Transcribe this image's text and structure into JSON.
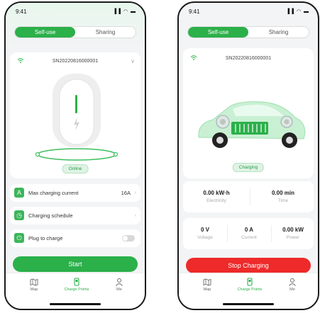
{
  "left": {
    "status_time": "9:41",
    "status_icons": "▐▐ ◠ ▬",
    "segments": [
      "Self-use",
      "Sharing"
    ],
    "device_sn": "SN20220816000001",
    "status_badge": "Online",
    "rows": [
      {
        "label": "Max charging current",
        "value": "16A",
        "icon": "A"
      },
      {
        "label": "Charging schedule",
        "value": "",
        "icon": "◷"
      },
      {
        "label": "Plug to charge",
        "value": "",
        "icon": "⏻"
      }
    ],
    "plug_to_charge_on": false,
    "action_button": "Start",
    "tabs": [
      "Map",
      "Charge Points",
      "Me"
    ]
  },
  "right": {
    "status_time": "9:41",
    "status_icons": "▐▐ ◠ ▬",
    "segments": [
      "Self-use",
      "Sharing"
    ],
    "device_sn": "SN20220816000001",
    "status_badge": "Charging",
    "stats_top": [
      {
        "value": "0.00 kW·h",
        "label": "Electricity"
      },
      {
        "value": "0.00 min",
        "label": "Time"
      }
    ],
    "stats_bottom": [
      {
        "value": "0 V",
        "label": "Voltage"
      },
      {
        "value": "0 A",
        "label": "Current"
      },
      {
        "value": "0.00 kW",
        "label": "Power"
      }
    ],
    "action_button": "Stop Charging",
    "tabs": [
      "Map",
      "Charge Points",
      "Me"
    ]
  },
  "colors": {
    "accent": "#2bb04a",
    "danger": "#ee2a2a"
  }
}
